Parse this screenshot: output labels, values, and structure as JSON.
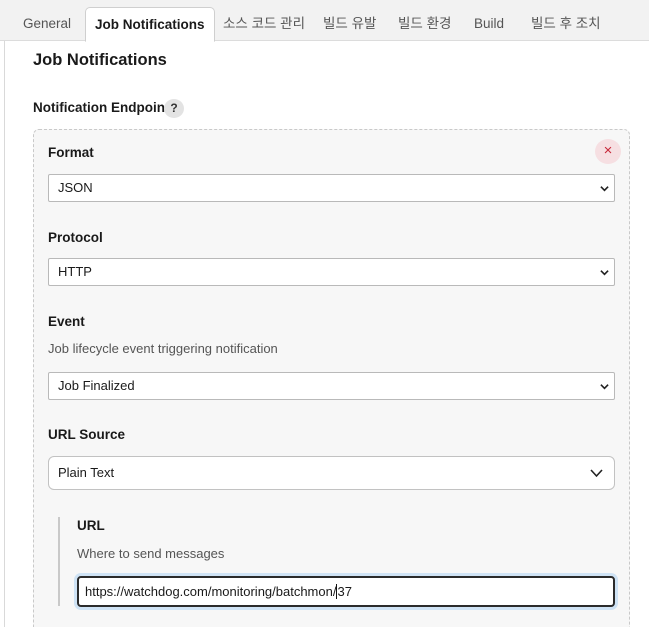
{
  "tabs": [
    {
      "label": "General"
    },
    {
      "label": "Job Notifications"
    },
    {
      "label": "소스 코드 관리"
    },
    {
      "label": "빌드 유발"
    },
    {
      "label": "빌드 환경"
    },
    {
      "label": "Build"
    },
    {
      "label": "빌드 후 조치"
    }
  ],
  "active_tab": "Job Notifications",
  "section": {
    "title": "Job Notifications",
    "endpoints_label": "Notification Endpoints",
    "help_glyph": "?"
  },
  "endpoint": {
    "remove_glyph": "×",
    "format": {
      "label": "Format",
      "value": "JSON"
    },
    "protocol": {
      "label": "Protocol",
      "value": "HTTP"
    },
    "event": {
      "label": "Event",
      "description": "Job lifecycle event triggering notification",
      "value": "Job Finalized"
    },
    "url_source": {
      "label": "URL Source",
      "value": "Plain Text"
    },
    "url": {
      "label": "URL",
      "description": "Where to send messages",
      "value_before_caret": "https://watchdog.com/monitoring/batchmon/",
      "value_after_caret": "37"
    }
  },
  "icons": {
    "help": "question-mark-icon",
    "remove": "close-icon",
    "select_arrow": "chevron-down-icon"
  },
  "colors": {
    "remove_bg": "#f6dfe2",
    "remove_fg": "#c8293a",
    "focus_ring": "#cfe3f5"
  }
}
